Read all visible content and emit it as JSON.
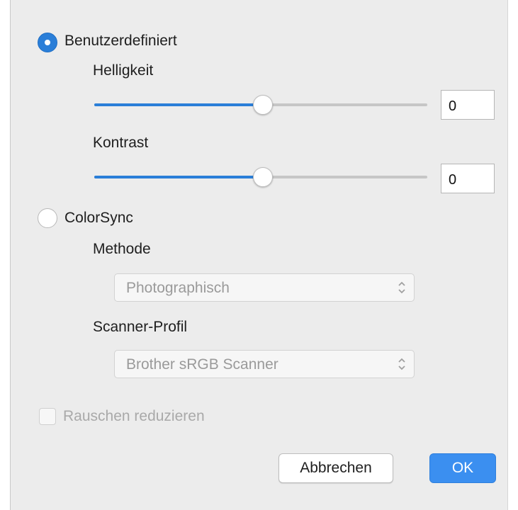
{
  "options": {
    "custom": {
      "label": "Benutzerdefiniert",
      "selected": true,
      "brightness": {
        "label": "Helligkeit",
        "value": "0",
        "slider_fraction": 0.5
      },
      "contrast": {
        "label": "Kontrast",
        "value": "0",
        "slider_fraction": 0.5
      }
    },
    "colorsync": {
      "label": "ColorSync",
      "selected": false,
      "method": {
        "label": "Methode",
        "selected": "Photographisch"
      },
      "scanner_profile": {
        "label": "Scanner-Profil",
        "selected": "Brother sRGB Scanner"
      }
    }
  },
  "noise_reduction": {
    "label": "Rauschen reduzieren",
    "checked": false,
    "enabled": false
  },
  "buttons": {
    "cancel": "Abbrechen",
    "ok": "OK"
  },
  "colors": {
    "accent": "#2a7ed8",
    "primary_button": "#3b8ff0",
    "background": "#ececec"
  }
}
